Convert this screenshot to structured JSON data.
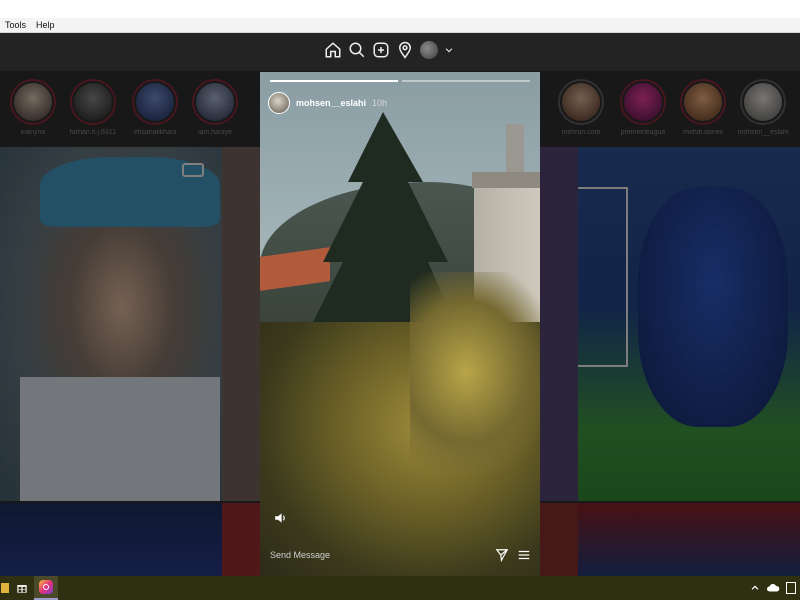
{
  "menubar": {
    "items": [
      "Tools",
      "Help"
    ]
  },
  "topnav": {
    "icons": [
      "home-icon",
      "search-icon",
      "add-post-icon",
      "location-icon",
      "profile-avatar",
      "chevron-down-icon"
    ]
  },
  "stories": [
    {
      "name": "inanyna",
      "color": "#7a2636"
    },
    {
      "name": "farhan.h.j.6311",
      "color": "#7a2636"
    },
    {
      "name": "ehsanalikhani",
      "color": "#7a2636"
    },
    {
      "name": "iam.haniye",
      "color": "#7a2636"
    },
    {
      "name": "mehran.com",
      "color": "#555555"
    },
    {
      "name": "premierleague",
      "color": "#7a2636"
    },
    {
      "name": "mehdi.daneii",
      "color": "#7a2636"
    },
    {
      "name": "mohsen__eslahi",
      "color": "#555555"
    }
  ],
  "viewer": {
    "username": "mohsen__eslahi",
    "time": "10h",
    "progress": [
      1.0,
      0.0
    ],
    "send_placeholder": "Send Message"
  },
  "taskbar": {
    "apps": [
      "explorer-icon",
      "store-icon",
      "instagram-app-icon"
    ],
    "tray": [
      "chevron-up-icon",
      "cloud-icon",
      "keyboard-icon"
    ]
  }
}
